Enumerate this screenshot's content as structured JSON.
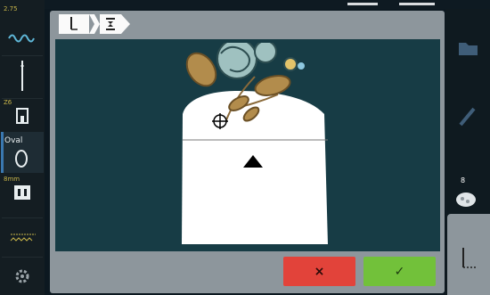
{
  "left_bar": {
    "top_number": "2.75",
    "mid_number": "Z6",
    "hoop_label": "Oval",
    "foot_label": "8mm"
  },
  "right_bar": {
    "color_count": "8"
  },
  "breadcrumb": {
    "items": [
      "needle-position-icon",
      "bobbin-icon"
    ]
  },
  "footer": {
    "cancel_label": "×",
    "confirm_label": "✓"
  },
  "colors": {
    "panel": "#8d969c",
    "canvas": "#173c45",
    "cancel": "#e2433a",
    "confirm": "#72c13a",
    "accent": "#3a78b0"
  }
}
